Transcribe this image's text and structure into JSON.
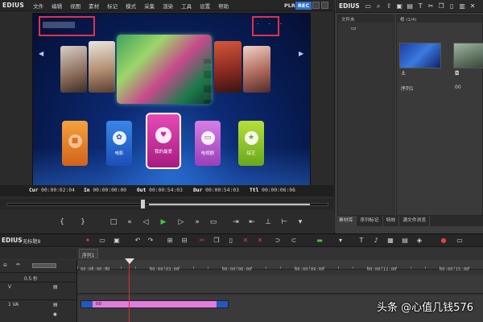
{
  "player": {
    "brand": "EDIUS",
    "menu": [
      "文件",
      "编辑",
      "视图",
      "素材",
      "标记",
      "模式",
      "采集",
      "渲染",
      "工具",
      "设置",
      "帮助"
    ],
    "mode_plr": "PLR",
    "mode_rec": "REC",
    "tiles": [
      {
        "label": "",
        "icon": "box-icon"
      },
      {
        "label": "电影",
        "icon": "film-reel-icon"
      },
      {
        "label": "我的最爱",
        "icon": "heart-icon"
      },
      {
        "label": "电视剧",
        "icon": "tv-icon"
      },
      {
        "label": "综艺",
        "icon": "star-icon"
      }
    ],
    "timecodes": {
      "cur_label": "Cur",
      "cur": "00:00:02:04",
      "in_label": "In",
      "in": "00:00:00:00",
      "out_label": "Out",
      "out": "00:00:54:03",
      "dur_label": "Dur",
      "dur": "00:00:54:03",
      "ttl_label": "Ttl",
      "ttl": "00:00:06:06"
    }
  },
  "bin": {
    "brand": "EDIUS",
    "folder_header": "文件夹",
    "root": "根 (1/4)",
    "clips": [
      {
        "name": "序列1"
      },
      {
        "name": "00"
      }
    ],
    "tabs": [
      "素材库",
      "序列标记",
      "特效",
      "源文件浏览"
    ]
  },
  "timeline": {
    "brand": "EDIUS",
    "sequence": "无标题8",
    "seq_tab": "序列1",
    "zoom": "0.5 秒",
    "clip_label": "00",
    "ruler": [
      "00:00:00:00",
      "00:00:03:00",
      "00:00:06:00",
      "00:00:09:00",
      "00:00:12:00",
      "00:00:15:00"
    ],
    "tracks": [
      "V",
      "1 VA"
    ]
  },
  "watermark": "头条 @心值几钱576"
}
